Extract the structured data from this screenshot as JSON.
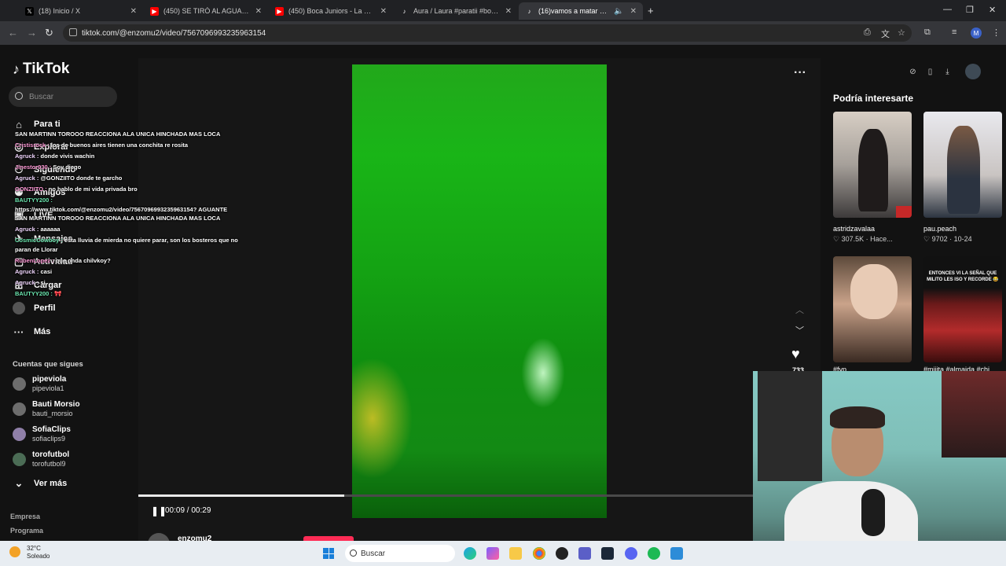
{
  "tabs": [
    {
      "title": "(18) Inicio / X",
      "icon": "x-icon",
      "color": "#000000"
    },
    {
      "title": "(450) SE TIRÓ AL AGUA. #futbo",
      "icon": "youtube-icon",
      "color": "#ff0000"
    },
    {
      "title": "(450) Boca Juniors - La Melodía",
      "icon": "youtube-icon",
      "color": "#ff0000"
    },
    {
      "title": "Aura / Laura #paratii #boca #ri",
      "icon": "tiktok-icon",
      "color": "#000000"
    },
    {
      "title": "(16)vamos a matar un men",
      "icon": "tiktok-icon",
      "color": "#000000"
    }
  ],
  "url": "tiktok.com/@enzomu2/video/7567096993235963154",
  "sidebar": {
    "logo": "TikTok",
    "search_placeholder": "Buscar",
    "nav": [
      "Para ti",
      "Explorar",
      "Siguiendo",
      "Amigos",
      "LIVE",
      "Mensajes",
      "Actividad",
      "Cargar",
      "Perfil",
      "Más"
    ],
    "following_title": "Cuentas que sigues",
    "following": [
      {
        "name": "pipeviola",
        "user": "pipeviola1"
      },
      {
        "name": "Bauti Morsio",
        "user": "bauti_morsio"
      },
      {
        "name": "SofiaClips",
        "user": "sofiaclips9"
      },
      {
        "name": "torofutbol",
        "user": "torofutbol9"
      }
    ],
    "see_more": "Ver más",
    "footer": [
      "Empresa",
      "Programa"
    ]
  },
  "video": {
    "timecode": "00:09 / 00:29",
    "progress": 0.335,
    "likes": "733",
    "author": "enzomu2"
  },
  "rail": {
    "title": "Podría interesarte",
    "items": [
      {
        "caption": "astridzavalaa",
        "likes": "307.5K",
        "date": "Hace..."
      },
      {
        "caption": "pau.peach",
        "likes": "9702",
        "date": "10-24"
      },
      {
        "caption": "#fyp",
        "likes": "",
        "date": ""
      },
      {
        "caption": "#mijita #almaida #chi",
        "likes": "",
        "date": ""
      }
    ],
    "overlay_text": "ENTONCES VI LA SEÑAL QUE MILITO LES ISO Y RECORDE 😂"
  },
  "chat": [
    {
      "user": "",
      "text": "SAN MARTINN TOROOO REACCIONA ALA UNICA HINCHADA MAS LOCA"
    },
    {
      "user": "Cristisrock :",
      "text": "los de buenos aires tienen una conchita re rosita"
    },
    {
      "user": "Agruck :",
      "text": "donde vivis wachin"
    },
    {
      "user": "Jinestor930 :",
      "text": "Soy diego"
    },
    {
      "user": "Agruck :",
      "text": "@GONZIITO donde te garcho"
    },
    {
      "user": "GONZIITO :",
      "text": "no hablo de mi vida privada bro"
    },
    {
      "user": "BAUTYY200 :",
      "text": ""
    },
    {
      "user": "",
      "text": "https://www.tiktok.com/@enzomu2/video/7567096993235963154? AGUANTE"
    },
    {
      "user": "",
      "text": "SAN MARTINN TOROOO REACCIONA ALA UNICA HINCHADA MAS LOCA"
    },
    {
      "user": "Agruck :",
      "text": "aaaaaa"
    },
    {
      "user": "CosmicCowboy :",
      "text": "esta lluvia de mierda no quiere parar, son los bosteros que no"
    },
    {
      "user": "",
      "text": "paran de Llorar"
    },
    {
      "user": "RubenLopez :",
      "text": "que onda chilvkoy?"
    },
    {
      "user": "Agruck :",
      "text": "casi"
    },
    {
      "user": "Agruck :",
      "text": "si"
    },
    {
      "user": "BAUTYY200 :",
      "text": "🎀"
    }
  ],
  "taskbar": {
    "temp": "32°C",
    "weather": "Soleado",
    "search": "Buscar"
  }
}
